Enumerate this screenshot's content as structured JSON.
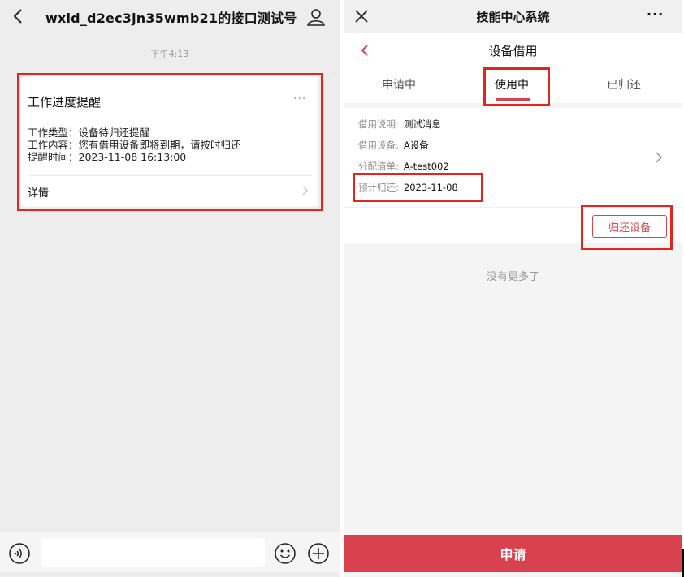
{
  "chat": {
    "title": "wxid_d2ec3jn35wmb21的接口测试号",
    "timestamp": "下午4:13",
    "card": {
      "title": "工作进度提醒",
      "more": "···",
      "lines": [
        "工作类型：设备待归还提醒",
        "工作内容：您有借用设备即将到期，请按时归还",
        "提醒时间：2023-11-08 16:13:00"
      ],
      "detail_label": "详情"
    },
    "input": {
      "value": "",
      "placeholder": ""
    }
  },
  "app": {
    "window_title": "技能中心系统",
    "more": "···",
    "page_title": "设备借用",
    "tabs": [
      {
        "label": "申请中",
        "active": false
      },
      {
        "label": "使用中",
        "active": true
      },
      {
        "label": "已归还",
        "active": false
      }
    ],
    "record": {
      "fields": [
        {
          "label": "借用说明:",
          "value": "测试消息"
        },
        {
          "label": "借用设备:",
          "value": "A设备"
        },
        {
          "label": "分配清单:",
          "value": "A-test002"
        },
        {
          "label": "预计归还:",
          "value": "2023-11-08"
        }
      ],
      "return_button": "归还设备"
    },
    "no_more": "没有更多了",
    "apply_button": "申请"
  },
  "colors": {
    "accent": "#d8424f",
    "highlight_box": "#e0261f",
    "chat_background": "#ededed"
  },
  "icons": {
    "chat_back": "chevron-left-icon",
    "chat_user": "user-icon",
    "chat_voice": "voice-icon",
    "chat_emoji": "emoji-icon",
    "chat_plus": "plus-circle-icon",
    "app_close": "close-icon",
    "app_back": "chevron-left-icon",
    "record_chevron": "chevron-right-icon"
  }
}
